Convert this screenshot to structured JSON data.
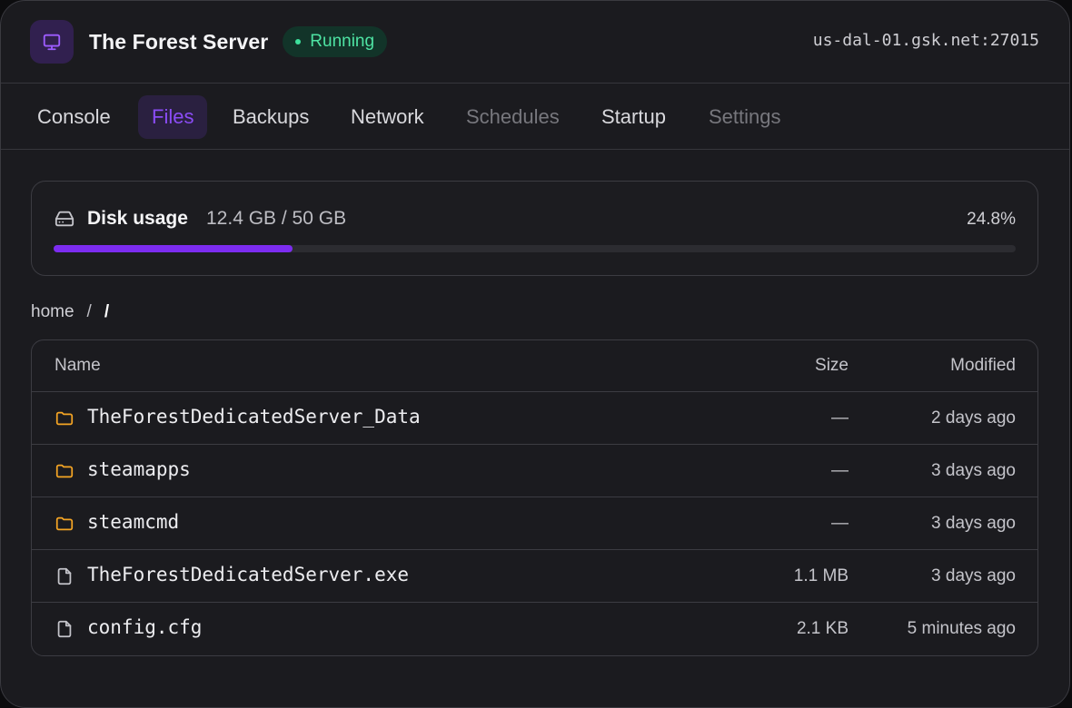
{
  "header": {
    "title": "The Forest Server",
    "status": "Running",
    "host": "us-dal-01.gsk.net:27015",
    "app_icon": "monitor-icon",
    "accent": "#8b4cf6",
    "status_color": "#4ee3a3"
  },
  "tabs": [
    {
      "label": "Console",
      "state": "normal"
    },
    {
      "label": "Files",
      "state": "active"
    },
    {
      "label": "Backups",
      "state": "normal"
    },
    {
      "label": "Network",
      "state": "normal"
    },
    {
      "label": "Schedules",
      "state": "disabled"
    },
    {
      "label": "Startup",
      "state": "normal"
    },
    {
      "label": "Settings",
      "state": "disabled"
    }
  ],
  "disk": {
    "icon": "hard-drive-icon",
    "label": "Disk usage",
    "amount": "12.4 GB / 50 GB",
    "percent_label": "24.8%",
    "used_fraction": 0.248,
    "bar_color": "#7c2cf0"
  },
  "breadcrumb": {
    "root": "home",
    "separator": "/",
    "current": "/"
  },
  "table": {
    "columns": {
      "name": "Name",
      "size": "Size",
      "modified": "Modified"
    },
    "rows": [
      {
        "type": "folder",
        "icon": "folder-icon",
        "name": "TheForestDedicatedServer_Data",
        "size": "—",
        "modified": "2 days ago"
      },
      {
        "type": "folder",
        "icon": "folder-icon",
        "name": "steamapps",
        "size": "—",
        "modified": "3 days ago"
      },
      {
        "type": "folder",
        "icon": "folder-icon",
        "name": "steamcmd",
        "size": "—",
        "modified": "3 days ago"
      },
      {
        "type": "file",
        "icon": "file-icon",
        "name": "TheForestDedicatedServer.exe",
        "size": "1.1 MB",
        "modified": "3 days ago"
      },
      {
        "type": "file",
        "icon": "file-icon",
        "name": "config.cfg",
        "size": "2.1 KB",
        "modified": "5 minutes ago"
      }
    ],
    "folder_color": "#f5a524"
  }
}
